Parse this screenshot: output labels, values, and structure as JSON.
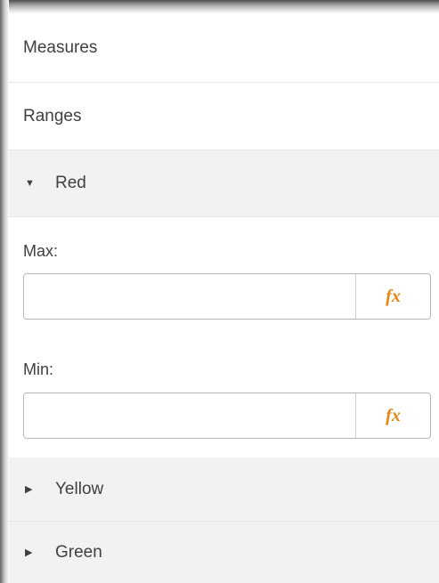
{
  "panel": {
    "rows": {
      "measures": "Measures",
      "ranges": "Ranges"
    },
    "sections": {
      "red": {
        "label": "Red",
        "expanded": true
      },
      "yellow": {
        "label": "Yellow",
        "expanded": false
      },
      "green": {
        "label": "Green",
        "expanded": false
      }
    },
    "red_fields": {
      "max": {
        "label": "Max:",
        "value": "",
        "button": "fx"
      },
      "min": {
        "label": "Min:",
        "value": "",
        "button": "fx"
      }
    }
  },
  "colors": {
    "section_bg": "#f2f2f2",
    "fx_accent": "#e6850f",
    "divider": "#e6e6e6"
  },
  "icons": {
    "expanded": "triangle-down-icon",
    "collapsed": "triangle-right-icon",
    "expression": "fx-icon"
  }
}
